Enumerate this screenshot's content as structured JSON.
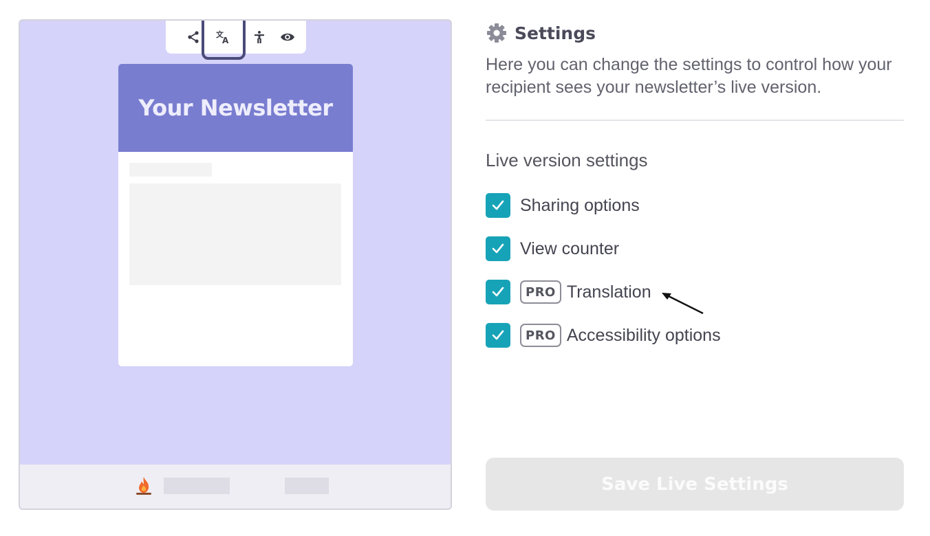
{
  "preview": {
    "toolbar": {
      "icons": [
        "share-icon",
        "translate-icon",
        "accessibility-icon",
        "eye-icon"
      ]
    },
    "newsletter": {
      "title": "Your Newsletter"
    },
    "footer": {
      "icon": "fire-icon"
    }
  },
  "settings": {
    "title": "Settings",
    "description": "Here you can change the settings to control how your recipient sees your newsletter’s live version.",
    "section_title": "Live version settings",
    "options": [
      {
        "label": "Sharing options",
        "checked": true,
        "pro": false
      },
      {
        "label": "View counter",
        "checked": true,
        "pro": false
      },
      {
        "label": "Translation",
        "checked": true,
        "pro": true,
        "pro_label": "PRO"
      },
      {
        "label": "Accessibility options",
        "checked": true,
        "pro": true,
        "pro_label": "PRO"
      }
    ],
    "save_label": "Save Live Settings"
  },
  "colors": {
    "accent": "#17a3b7",
    "preview_bg": "#d5d3f9",
    "newsletter_header": "#797dd0",
    "highlight_border": "#4a4b78"
  }
}
